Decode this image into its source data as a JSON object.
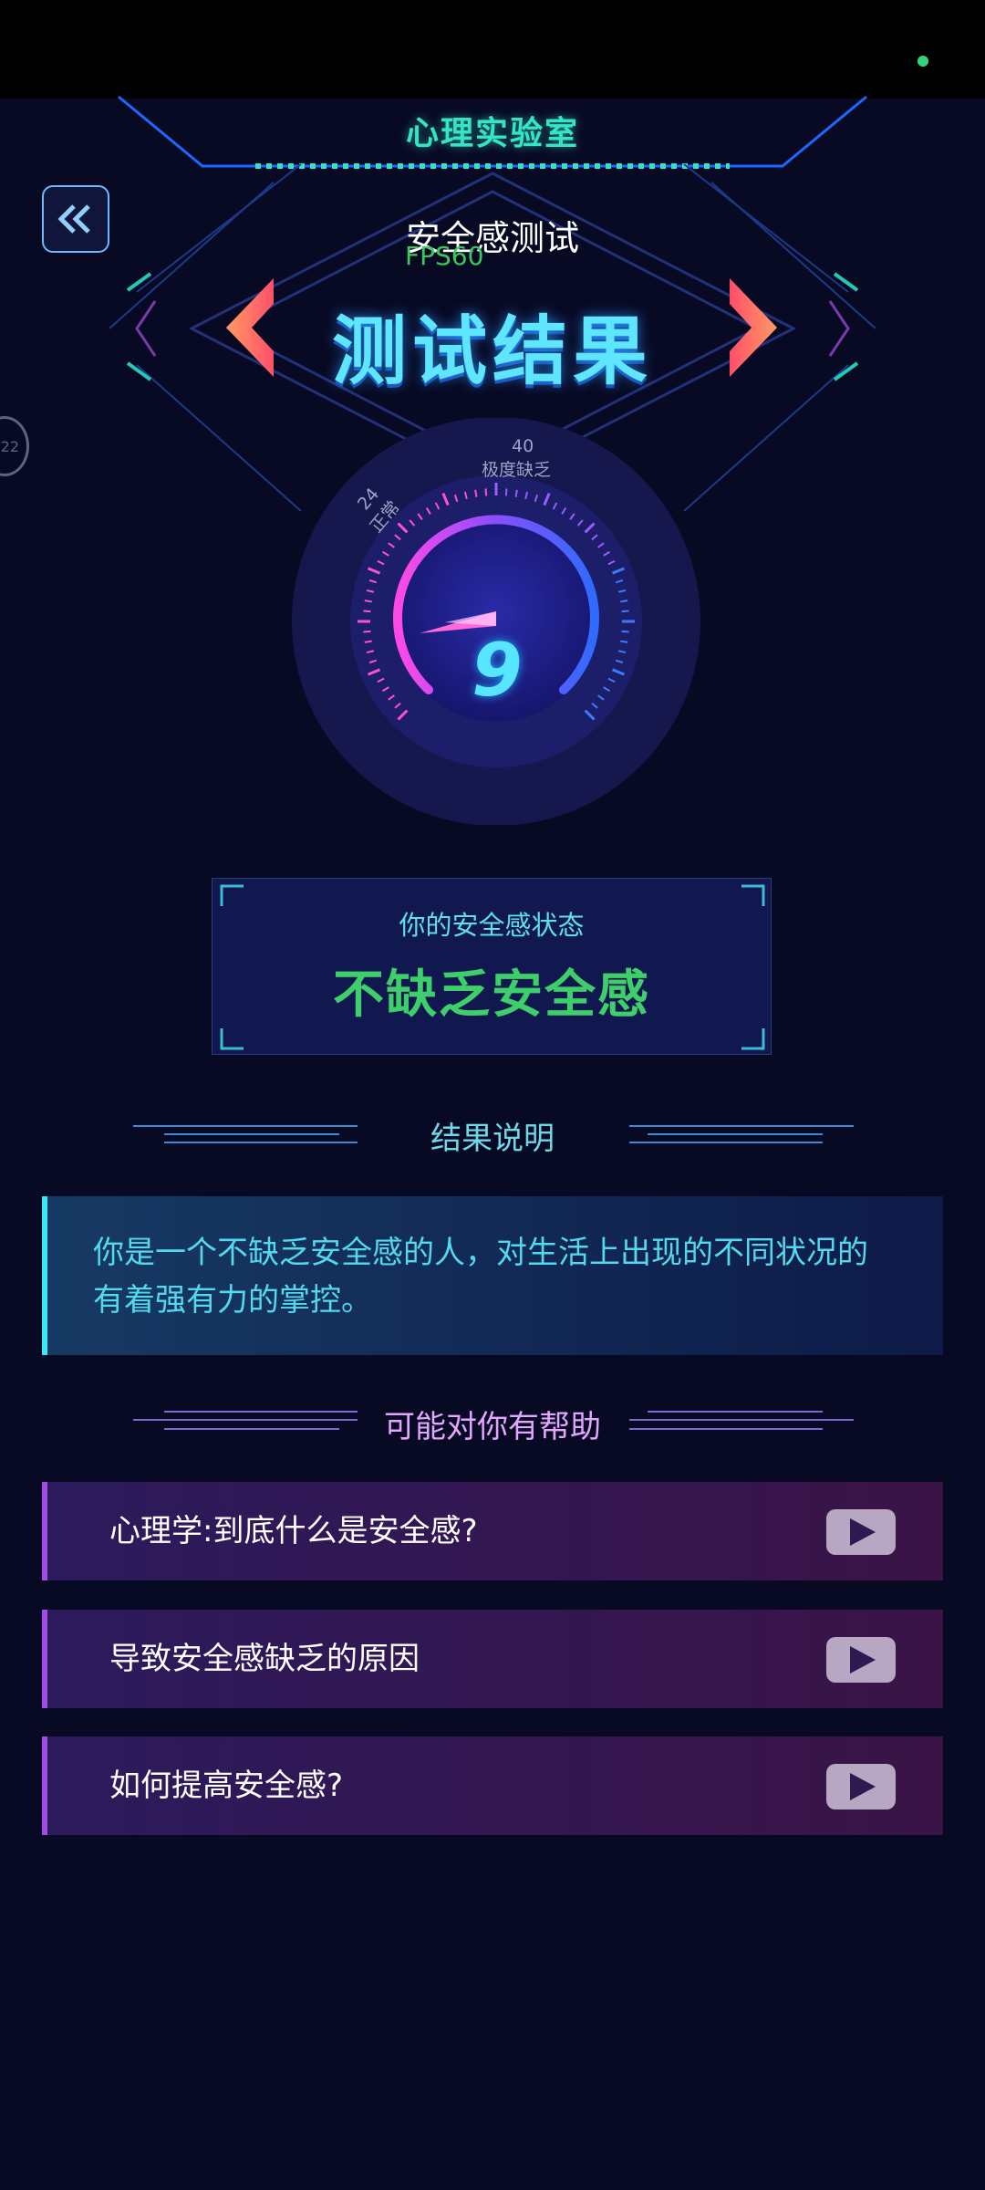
{
  "header": {
    "lab_title": "心理实验室",
    "subtitle": "安全感测试",
    "fps": "FPS60",
    "big_title": "测试结果",
    "side_badge": "22"
  },
  "gauge": {
    "value": "9",
    "label_top_value": "40",
    "label_top_text": "极度缺乏",
    "label_left_value": "24",
    "label_left_text": "正常"
  },
  "status": {
    "label": "你的安全感状态",
    "value": "不缺乏安全感"
  },
  "explain": {
    "heading": "结果说明",
    "text": "你是一个不缺乏安全感的人，对生活上出现的不同状况的有着强有力的掌控。"
  },
  "help": {
    "heading": "可能对你有帮助",
    "items": [
      {
        "label": "心理学:到底什么是安全感?"
      },
      {
        "label": "导致安全感缺乏的原因"
      },
      {
        "label": "如何提高安全感?"
      }
    ]
  },
  "colors": {
    "accent_cyan": "#5fe6ff",
    "status_green": "#3fcf6a",
    "help_purple": "#e2a6ff"
  }
}
